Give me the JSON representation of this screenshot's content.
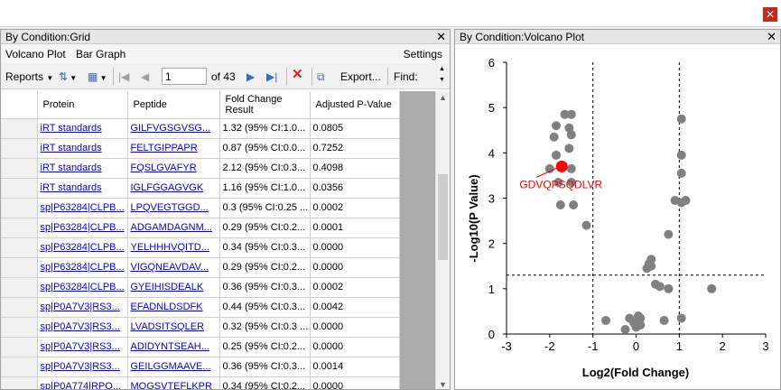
{
  "left_panel": {
    "title": "By Condition:Grid",
    "menu": {
      "volcano": "Volcano Plot",
      "bar": "Bar Graph",
      "settings": "Settings"
    },
    "toolbar": {
      "reports": "Reports",
      "page_value": "1",
      "of_label": "of 43",
      "export": "Export...",
      "find": "Find:"
    },
    "columns": [
      "Protein",
      "Peptide",
      "Fold Change Result",
      "Adjusted P-Value"
    ],
    "rows": [
      [
        "iRT standards",
        "GILFVGSGVSG...",
        "1.32 (95% CI:1.0...",
        "0.0805"
      ],
      [
        "iRT standards",
        "FELTGIPPAPR",
        "0.87 (95% CI:0.0...",
        "0.7252"
      ],
      [
        "iRT standards",
        "FQSLGVAFYR",
        "2.12 (95% CI:0.3...",
        "0.4098"
      ],
      [
        "iRT standards",
        "IGLFGGAGVGK",
        "1.16 (95% CI:1.0...",
        "0.0356"
      ],
      [
        "sp|P63284|CLPB...",
        "LPQVEGTGGD...",
        "0.3 (95% CI:0.25 ...",
        "0.0002"
      ],
      [
        "sp|P63284|CLPB...",
        "ADGAMDAGNM...",
        "0.29 (95% CI:0.2...",
        "0.0001"
      ],
      [
        "sp|P63284|CLPB...",
        "YELHHHVQITD...",
        "0.34 (95% CI:0.3...",
        "0.0000"
      ],
      [
        "sp|P63284|CLPB...",
        "VIGQNEAVDAV...",
        "0.29 (95% CI:0.2...",
        "0.0000"
      ],
      [
        "sp|P63284|CLPB...",
        "GYEIHISDEALK",
        "0.36 (95% CI:0.3...",
        "0.0002"
      ],
      [
        "sp|P0A7V3|RS3...",
        "EFADNLDSDFK",
        "0.44 (95% CI:0.3...",
        "0.0042"
      ],
      [
        "sp|P0A7V3|RS3...",
        "LVADSITSQLER",
        "0.32 (95% CI:0.3 ...",
        "0.0000"
      ],
      [
        "sp|P0A7V3|RS3...",
        "ADIDYNTSEAH...",
        "0.25 (95% CI:0.2...",
        "0.0000"
      ],
      [
        "sp|P0A7V3|RS3...",
        "GEILGGMAAVE...",
        "0.36 (95% CI:0.3...",
        "0.0014"
      ],
      [
        "sp|P0A774|RPO...",
        "MQGSVTEFLKPR",
        "0.34 (95% CI:0.2...",
        "0.0000"
      ]
    ]
  },
  "right_panel": {
    "title": "By Condition:Volcano Plot"
  },
  "chart_data": {
    "type": "scatter",
    "xlabel": "Log2(Fold Change)",
    "ylabel": "-Log10(P Value)",
    "xlim": [
      -3,
      3
    ],
    "ylim": [
      0,
      6
    ],
    "xticks": [
      "-3",
      "-2",
      "-1",
      "0",
      "1",
      "2",
      "3"
    ],
    "yticks": [
      "0",
      "1",
      "2",
      "3",
      "4",
      "5",
      "6"
    ],
    "thresholds": {
      "x": [
        -1,
        1
      ],
      "y": 1.3
    },
    "highlight": {
      "label": "GDVQPSQDLVR",
      "x": -1.72,
      "y": 3.7,
      "color": "#ff0000"
    },
    "point_color": "#808080",
    "points": [
      [
        -1.65,
        4.85
      ],
      [
        -1.5,
        4.85
      ],
      [
        -1.85,
        4.6
      ],
      [
        -1.55,
        4.55
      ],
      [
        -1.5,
        4.4
      ],
      [
        -1.9,
        4.35
      ],
      [
        -1.55,
        4.1
      ],
      [
        -1.85,
        3.95
      ],
      [
        -2.0,
        3.65
      ],
      [
        -1.5,
        3.65
      ],
      [
        -1.8,
        3.35
      ],
      [
        -1.5,
        3.35
      ],
      [
        -1.75,
        2.85
      ],
      [
        -1.45,
        2.85
      ],
      [
        -1.15,
        2.4
      ],
      [
        1.05,
        4.75
      ],
      [
        1.05,
        3.95
      ],
      [
        1.05,
        3.55
      ],
      [
        1.05,
        2.9
      ],
      [
        1.15,
        2.95
      ],
      [
        0.9,
        2.95
      ],
      [
        0.75,
        2.2
      ],
      [
        0.35,
        1.65
      ],
      [
        0.3,
        1.55
      ],
      [
        0.35,
        1.5
      ],
      [
        0.25,
        1.45
      ],
      [
        0.45,
        1.1
      ],
      [
        0.55,
        1.05
      ],
      [
        0.75,
        1.0
      ],
      [
        1.75,
        1.0
      ],
      [
        -0.7,
        0.3
      ],
      [
        -0.15,
        0.35
      ],
      [
        0.05,
        0.4
      ],
      [
        0.1,
        0.35
      ],
      [
        -0.05,
        0.25
      ],
      [
        0.1,
        0.2
      ],
      [
        0.0,
        0.15
      ],
      [
        -0.25,
        0.1
      ],
      [
        0.65,
        0.3
      ],
      [
        1.05,
        0.35
      ]
    ]
  }
}
